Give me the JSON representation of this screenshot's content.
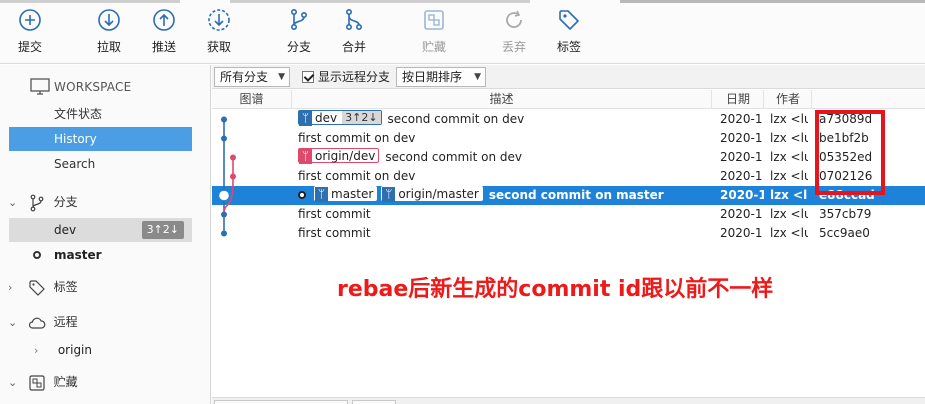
{
  "toolbar": {
    "buttons": [
      {
        "label": "提交",
        "icon": "commit-plus-icon",
        "disabled": false
      },
      {
        "label": "拉取",
        "icon": "pull-icon",
        "disabled": false
      },
      {
        "label": "推送",
        "icon": "push-icon",
        "disabled": false
      },
      {
        "label": "获取",
        "icon": "fetch-icon",
        "disabled": false
      },
      {
        "label": "分支",
        "icon": "branch-icon",
        "disabled": false
      },
      {
        "label": "合并",
        "icon": "merge-icon",
        "disabled": false
      },
      {
        "label": "贮藏",
        "icon": "stash-icon",
        "disabled": true
      },
      {
        "label": "丢弃",
        "icon": "discard-icon",
        "disabled": true
      },
      {
        "label": "标签",
        "icon": "tag-icon",
        "disabled": false
      }
    ]
  },
  "sidebar": {
    "workspace_title": "WORKSPACE",
    "workspace_items": [
      "文件状态",
      "History",
      "Search"
    ],
    "selected_workspace_item": "History",
    "groups": {
      "branches": "分支",
      "tags": "标签",
      "remotes": "远程",
      "stashes": "贮藏"
    },
    "branches": [
      {
        "name": "dev",
        "badge": "3↑2↓",
        "selected": true
      },
      {
        "name": "master",
        "current": true
      }
    ],
    "remotes": [
      {
        "name": "origin"
      }
    ]
  },
  "filters": {
    "branch_filter": "所有分支",
    "show_remote_label": "显示远程分支",
    "show_remote_checked": true,
    "sort": "按日期排序"
  },
  "columns": {
    "graph": "图谱",
    "description": "描述",
    "date": "日期",
    "author": "作者"
  },
  "commits": [
    {
      "message": "second commit on dev",
      "date": "2020-1",
      "author": "lzx <lu",
      "hash": "a73089d",
      "tags": [
        {
          "name": "dev",
          "style": "blue",
          "count": "3↑2↓"
        }
      ]
    },
    {
      "message": "first commit on dev",
      "date": "2020-1",
      "author": "lzx <lu",
      "hash": "be1bf2b",
      "tags": []
    },
    {
      "message": "second commit on dev",
      "date": "2020-1",
      "author": "lzx <lu",
      "hash": "05352ed",
      "tags": [
        {
          "name": "origin/dev",
          "style": "red"
        }
      ]
    },
    {
      "message": "first commit on dev",
      "date": "2020-1",
      "author": "lzx <lu",
      "hash": "0702126",
      "tags": []
    },
    {
      "message": "second commit on master",
      "date": "2020-1",
      "author": "lzx <lu",
      "hash": "e88ccad",
      "selected": true,
      "head": true,
      "tags": [
        {
          "name": "master",
          "style": "white"
        },
        {
          "name": "origin/master",
          "style": "white"
        }
      ]
    },
    {
      "message": "first commit",
      "date": "2020-1",
      "author": "lzx <lu",
      "hash": "357cb79",
      "tags": []
    },
    {
      "message": "first commit",
      "date": "2020-1",
      "author": "lzx <lu",
      "hash": "5cc9ae0",
      "tags": []
    }
  ],
  "annotation": "rebae后新生成的commit id跟以前不一样",
  "colors": {
    "accent": "#1e83d8",
    "sidebar_selected": "#4b9ee3",
    "graph_blue": "#2e6fb0",
    "graph_red": "#e04a6a",
    "annotation_red": "#ee1a1a"
  }
}
